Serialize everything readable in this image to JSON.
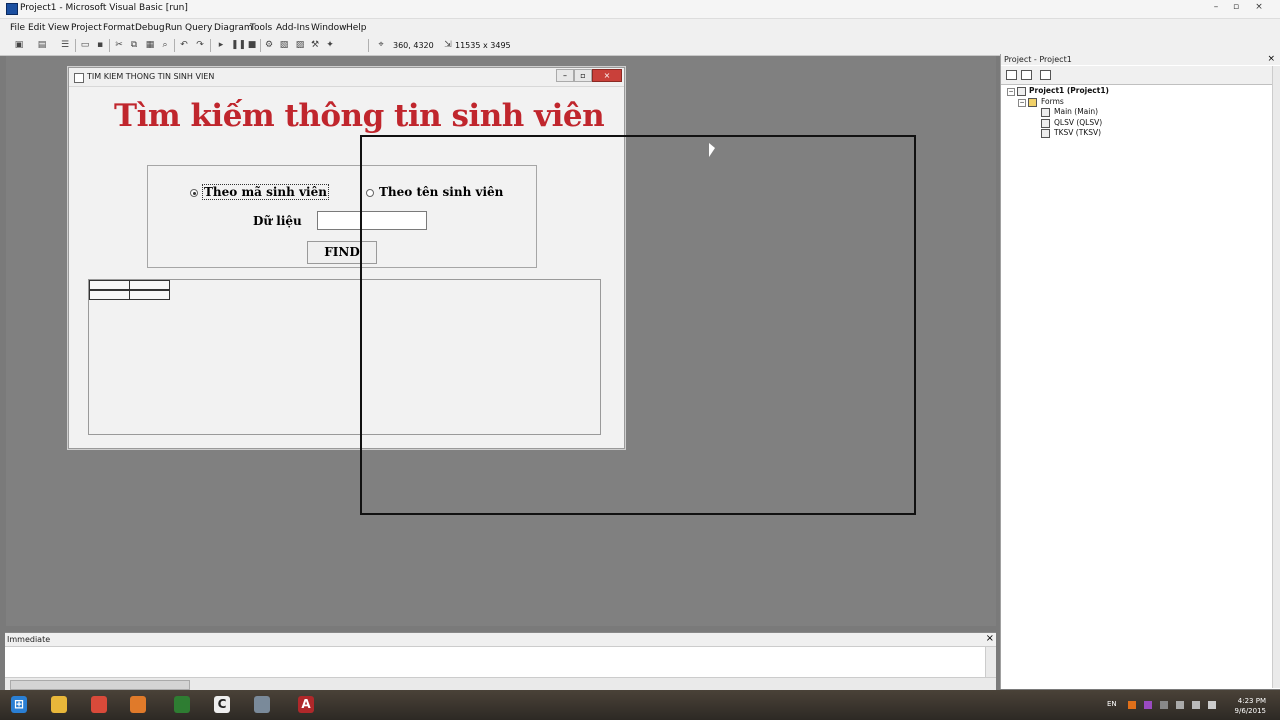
{
  "window": {
    "title": "Project1 - Microsoft Visual Basic [run]",
    "controls": [
      "–",
      "▫",
      "×"
    ]
  },
  "menu": [
    "File",
    "Edit",
    "View",
    "Project",
    "Format",
    "Debug",
    "Run",
    "Query",
    "Diagram",
    "Tools",
    "Add-Ins",
    "Window",
    "Help"
  ],
  "toolbar": {
    "position_readout": "360, 4320",
    "size_readout": "11535 x 3495"
  },
  "form": {
    "title": "TIM KIEM THONG TIN SINH VIEN",
    "controls": [
      "–",
      "▫",
      "×"
    ],
    "heading": "Tìm kiếm thông tin sinh viên",
    "options": [
      {
        "label": "Theo mã sinh viên",
        "selected": true
      },
      {
        "label": "Theo tên sinh viên",
        "selected": false
      }
    ],
    "data_label": "Dữ liệu",
    "data_value": "",
    "find_label": "FIND"
  },
  "project": {
    "title": "Project - Project1",
    "close": "×",
    "tree": {
      "root": "Project1 (Project1)",
      "folder": "Forms",
      "forms": [
        "Main (Main)",
        "QLSV (QLSV)",
        "TKSV (TKSV)"
      ]
    }
  },
  "immediate": {
    "title": "Immediate",
    "close": "×"
  },
  "taskbar": {
    "apps": [
      {
        "name": "start",
        "color": "#2a7fd4",
        "glyph": "⊞"
      },
      {
        "name": "explorer",
        "color": "#e8b73a",
        "glyph": ""
      },
      {
        "name": "chrome",
        "color": "#d94a3a",
        "glyph": ""
      },
      {
        "name": "firefox",
        "color": "#e07a2a",
        "glyph": ""
      },
      {
        "name": "excel",
        "color": "#2e7d32",
        "glyph": ""
      },
      {
        "name": "app-c",
        "color": "#eeeeee",
        "glyph": "C"
      },
      {
        "name": "vb",
        "color": "#7a8a9a",
        "glyph": ""
      },
      {
        "name": "access",
        "color": "#b0282a",
        "glyph": "A"
      }
    ],
    "lang": "EN",
    "time": "4:23 PM",
    "date": "9/6/2015"
  }
}
